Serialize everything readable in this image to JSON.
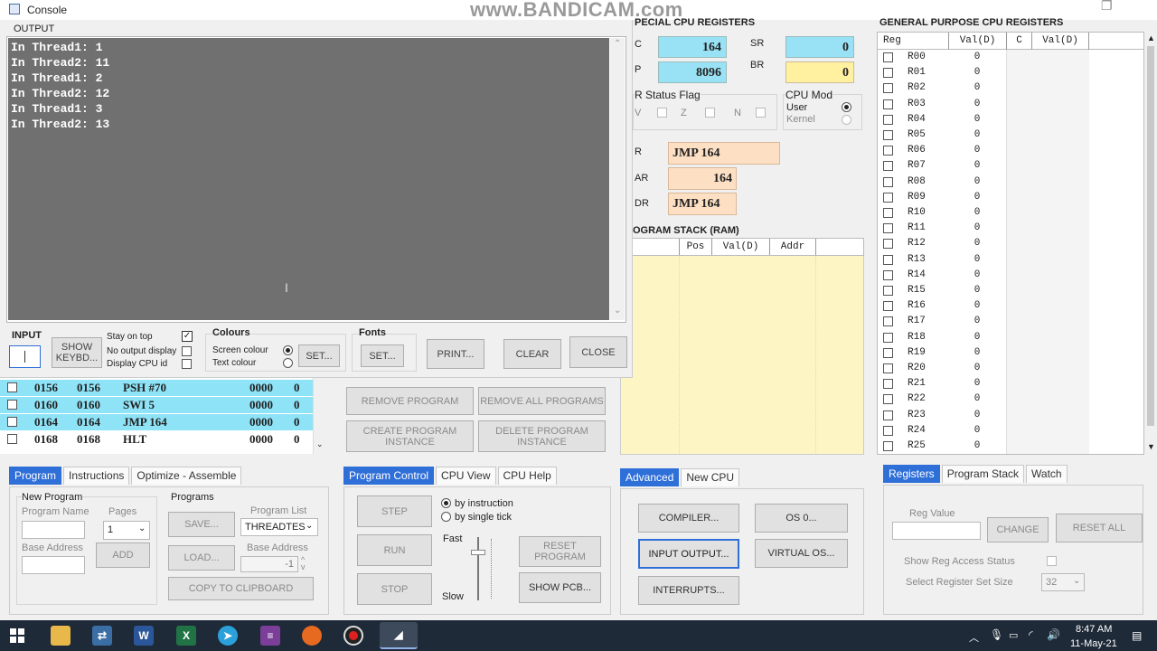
{
  "watermark": "www.BANDICAM.com",
  "console": {
    "title": "Console",
    "output_label": "OUTPUT",
    "lines": [
      "In Thread1: 1",
      "In Thread2: 11",
      "In Thread1: 2",
      "In Thread2: 12",
      "In Thread1: 3",
      "In Thread2: 13"
    ],
    "input_label": "INPUT",
    "show_keybd": "SHOW\nKEYBD...",
    "stay_on_top": "Stay on top",
    "no_output_display": "No output display",
    "display_cpu_id": "Display CPU id",
    "colours_label": "Colours",
    "screen_colour": "Screen colour",
    "text_colour": "Text colour",
    "set_colour_btn": "SET...",
    "fonts_label": "Fonts",
    "set_font_btn": "SET...",
    "print_btn": "PRINT...",
    "clear_btn": "CLEAR",
    "close_btn": "CLOSE"
  },
  "special_regs": {
    "title": "PECIAL CPU REGISTERS",
    "pc_label": "C",
    "pc_value": "164",
    "sp_label": "P",
    "sp_value": "8096",
    "sr_label": "SR",
    "sr_value": "0",
    "br_label": "BR",
    "br_value": "0",
    "status_flag_label": "R Status Flag",
    "flags": [
      "V",
      "Z",
      "N"
    ],
    "cpu_mode_label": "CPU Mod",
    "user_label": "User",
    "kernel_label": "Kernel",
    "ir_label": "R",
    "ir_value": "JMP 164",
    "mar_label": "AR",
    "mar_value": "164",
    "mdr_label": "DR",
    "mdr_value": "JMP 164"
  },
  "program_stack": {
    "title": "OGRAM STACK (RAM)",
    "headers": [
      "Pos",
      "Val(D)",
      "Addr"
    ]
  },
  "gp_regs": {
    "title": "GENERAL PURPOSE CPU REGISTERS",
    "headers": [
      "Reg",
      "Val(D)",
      "C",
      "Val(D)"
    ],
    "rows": [
      {
        "name": "R00",
        "val": "0"
      },
      {
        "name": "R01",
        "val": "0"
      },
      {
        "name": "R02",
        "val": "0"
      },
      {
        "name": "R03",
        "val": "0"
      },
      {
        "name": "R04",
        "val": "0"
      },
      {
        "name": "R05",
        "val": "0"
      },
      {
        "name": "R06",
        "val": "0"
      },
      {
        "name": "R07",
        "val": "0"
      },
      {
        "name": "R08",
        "val": "0"
      },
      {
        "name": "R09",
        "val": "0"
      },
      {
        "name": "R10",
        "val": "0"
      },
      {
        "name": "R11",
        "val": "0"
      },
      {
        "name": "R12",
        "val": "0"
      },
      {
        "name": "R13",
        "val": "0"
      },
      {
        "name": "R14",
        "val": "0"
      },
      {
        "name": "R15",
        "val": "0"
      },
      {
        "name": "R16",
        "val": "0"
      },
      {
        "name": "R17",
        "val": "0"
      },
      {
        "name": "R18",
        "val": "0"
      },
      {
        "name": "R19",
        "val": "0"
      },
      {
        "name": "R20",
        "val": "0"
      },
      {
        "name": "R21",
        "val": "0"
      },
      {
        "name": "R22",
        "val": "0"
      },
      {
        "name": "R23",
        "val": "0"
      },
      {
        "name": "R24",
        "val": "0"
      },
      {
        "name": "R25",
        "val": "0"
      }
    ]
  },
  "instr_rows": [
    {
      "a": "0156",
      "b": "0156",
      "instr": "PSH #70",
      "c": "0000",
      "d": "0"
    },
    {
      "a": "0160",
      "b": "0160",
      "instr": "SWI 5",
      "c": "0000",
      "d": "0"
    },
    {
      "a": "0164",
      "b": "0164",
      "instr": "JMP 164",
      "c": "0000",
      "d": "0"
    },
    {
      "a": "0168",
      "b": "0168",
      "instr": "HLT",
      "c": "0000",
      "d": "0"
    }
  ],
  "program_buttons": {
    "remove_program": "REMOVE PROGRAM",
    "remove_all": "REMOVE ALL PROGRAMS",
    "create_instance": "CREATE PROGRAM\nINSTANCE",
    "delete_instance": "DELETE PROGRAM\nINSTANCE"
  },
  "program_panel": {
    "tabs": [
      "Program",
      "Instructions",
      "Optimize - Assemble"
    ],
    "new_program": "New Program",
    "program_name": "Program Name",
    "pages": "Pages",
    "pages_value": "1",
    "base_address": "Base Address",
    "add": "ADD",
    "programs": "Programs",
    "program_list": "Program List",
    "program_list_value": "THREADTES",
    "save": "SAVE...",
    "load": "LOAD...",
    "base_address2": "Base Address",
    "base_value": "-1",
    "copy": "COPY TO CLIPBOARD"
  },
  "control_panel": {
    "tabs": [
      "Program Control",
      "CPU View",
      "CPU Help"
    ],
    "step": "STEP",
    "run": "RUN",
    "stop": "STOP",
    "by_instruction": "by instruction",
    "by_single_tick": "by single tick",
    "fast": "Fast",
    "slow": "Slow",
    "reset_program": "RESET\nPROGRAM",
    "show_pcb": "SHOW PCB..."
  },
  "advanced_panel": {
    "tabs": [
      "Advanced",
      "New CPU"
    ],
    "compiler": "COMPILER...",
    "os": "OS 0...",
    "input_output": "INPUT OUTPUT...",
    "virtual_os": "VIRTUAL OS...",
    "interrupts": "INTERRUPTS..."
  },
  "registers_panel": {
    "tabs": [
      "Registers",
      "Program Stack",
      "Watch"
    ],
    "reg_value": "Reg Value",
    "change": "CHANGE",
    "reset_all": "RESET ALL",
    "show_access": "Show Reg Access Status",
    "select_size": "Select Register Set Size",
    "size_value": "32"
  },
  "taskbar": {
    "time": "8:47 AM",
    "date": "11-May-21"
  }
}
